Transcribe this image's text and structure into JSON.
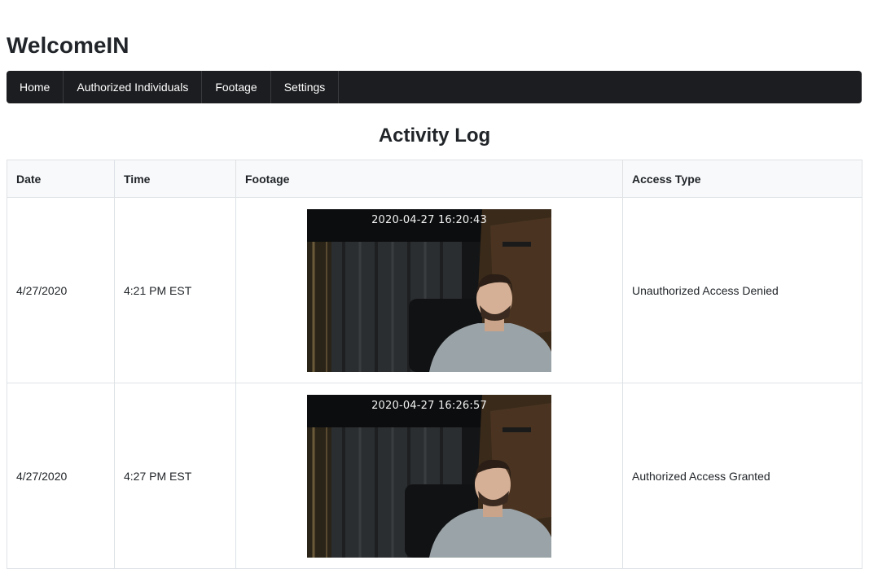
{
  "app": {
    "title": "WelcomeIN"
  },
  "nav": {
    "items": [
      {
        "label": "Home"
      },
      {
        "label": "Authorized Individuals"
      },
      {
        "label": "Footage"
      },
      {
        "label": "Settings"
      }
    ]
  },
  "main": {
    "title": "Activity Log",
    "table": {
      "headers": {
        "date": "Date",
        "time": "Time",
        "footage": "Footage",
        "access_type": "Access Type"
      },
      "rows": [
        {
          "date": "4/27/2020",
          "time": "4:21 PM EST",
          "footage_timestamp": "2020-04-27  16:20:43",
          "access_type": "Unauthorized Access Denied"
        },
        {
          "date": "4/27/2020",
          "time": "4:27 PM EST",
          "footage_timestamp": "2020-04-27  16:26:57",
          "access_type": "Authorized Access Granted"
        }
      ]
    }
  },
  "colors": {
    "navbar_bg": "#1c1d20",
    "header_bg": "#f8f9fa",
    "border": "#dee2e6"
  }
}
